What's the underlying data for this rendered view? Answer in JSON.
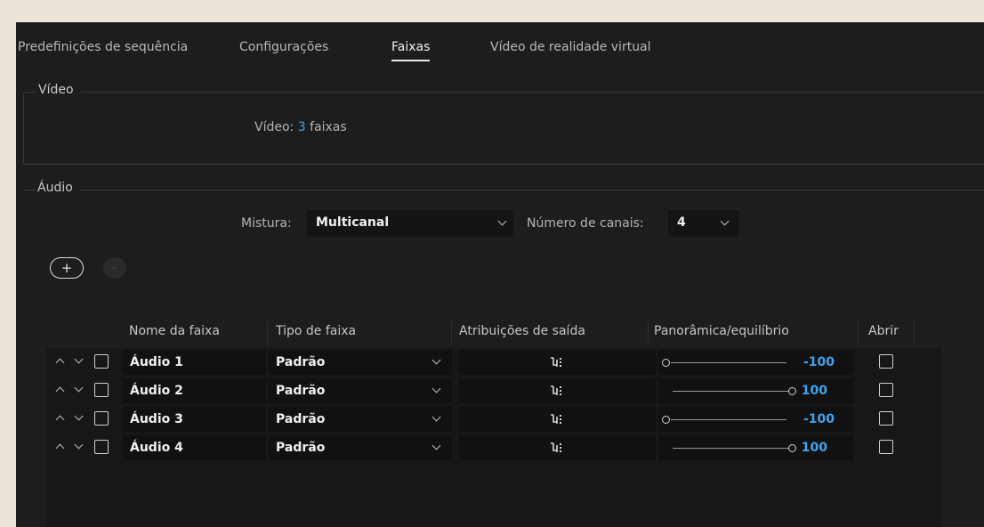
{
  "tabs": [
    {
      "label": "Predefinições de sequência",
      "active": false
    },
    {
      "label": "Configurações",
      "active": false
    },
    {
      "label": "Faixas",
      "active": true
    },
    {
      "label": "Vídeo de realidade virtual",
      "active": false
    }
  ],
  "video": {
    "group_title": "Vídeo",
    "label": "Vídeo:",
    "count": "3",
    "unit": "faixas"
  },
  "audio": {
    "group_title": "Áudio",
    "mix_label": "Mistura:",
    "mix_value": "Multicanal",
    "channels_label": "Número de canais:",
    "channels_value": "4",
    "add_button": "+",
    "remove_button": "-"
  },
  "table": {
    "columns": [
      "Nome da faixa",
      "Tipo de faixa",
      "Atribuições de saída",
      "Panorâmica/equilíbrio",
      "Abrir"
    ],
    "rows": [
      {
        "name": "Áudio 1",
        "type": "Padrão",
        "pan": "-100"
      },
      {
        "name": "Áudio 2",
        "type": "Padrão",
        "pan": "100"
      },
      {
        "name": "Áudio 3",
        "type": "Padrão",
        "pan": "-100"
      },
      {
        "name": "Áudio 4",
        "type": "Padrão",
        "pan": "100"
      }
    ]
  },
  "colors": {
    "accent": "#3fa4f2",
    "panel": "#1d1d1d",
    "field": "#111111"
  }
}
